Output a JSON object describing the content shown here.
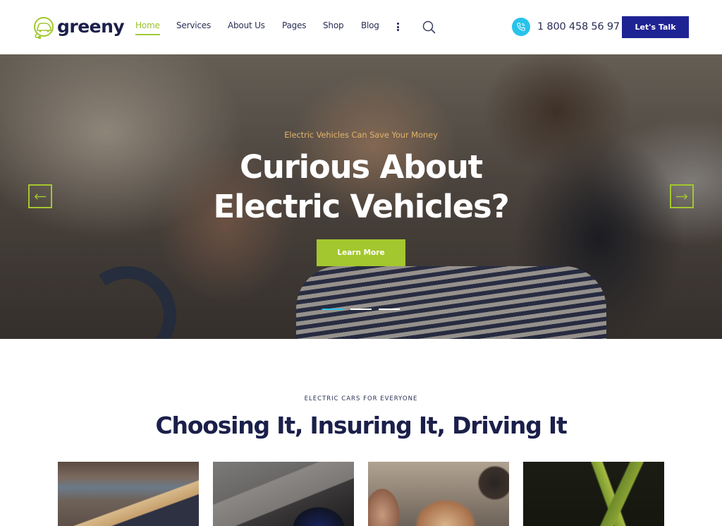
{
  "header": {
    "brand": "greeny",
    "nav": [
      {
        "label": "Home",
        "active": true
      },
      {
        "label": "Services",
        "active": false
      },
      {
        "label": "About Us",
        "active": false
      },
      {
        "label": "Pages",
        "active": false
      },
      {
        "label": "Shop",
        "active": false
      },
      {
        "label": "Blog",
        "active": false
      }
    ],
    "more_icon": "more-vertical-icon",
    "search_icon": "search-icon",
    "phone_icon": "phone-icon",
    "phone": "1 800 458 56 97",
    "cta_label": "Let's Talk"
  },
  "hero": {
    "subtitle": "Electric Vehicles Can Save Your Money",
    "title": "Curious About Electric Vehicles?",
    "button_label": "Learn More",
    "prev_icon": "arrow-left-icon",
    "next_icon": "arrow-right-icon",
    "slides_total": 3,
    "active_slide": 1
  },
  "section": {
    "eyebrow": "ELECTRIC CARS FOR EVERYONE",
    "title": "Choosing It, Insuring It, Driving It",
    "cards": [
      {
        "image": "car-hood-photo"
      },
      {
        "image": "charging-port-photo"
      },
      {
        "image": "friends-in-car-photo"
      },
      {
        "image": "green-leaves-photo"
      }
    ]
  },
  "colors": {
    "brand_navy": "#1b1f4a",
    "accent_green": "#a3c72e",
    "cta_blue": "#1e2394",
    "phone_cyan": "#27c3ea",
    "subtitle_gold": "#e2b36a"
  }
}
